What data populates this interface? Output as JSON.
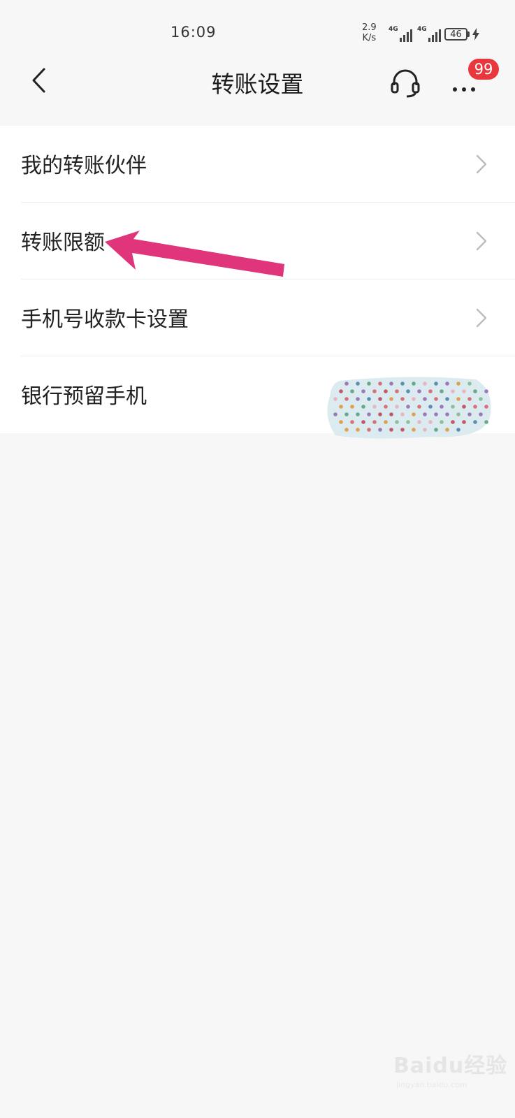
{
  "status_bar": {
    "time": "16:09",
    "net_speed_value": "2.9",
    "net_speed_unit": "K/s",
    "sim1_label": "4G",
    "sim2_label": "4G",
    "battery": "46"
  },
  "header": {
    "title": "转账设置",
    "notification_count": "99"
  },
  "settings": {
    "items": [
      {
        "label": "我的转账伙伴"
      },
      {
        "label": "转账限额"
      },
      {
        "label": "手机号收款卡设置"
      },
      {
        "label": "银行预留手机"
      }
    ]
  },
  "watermark": {
    "main": "Baidu经验",
    "sub": "jingyan.baidu.com"
  },
  "colors": {
    "badge": "#e8383d",
    "annotation_arrow": "#e0357a",
    "background": "#f7f7f7"
  }
}
